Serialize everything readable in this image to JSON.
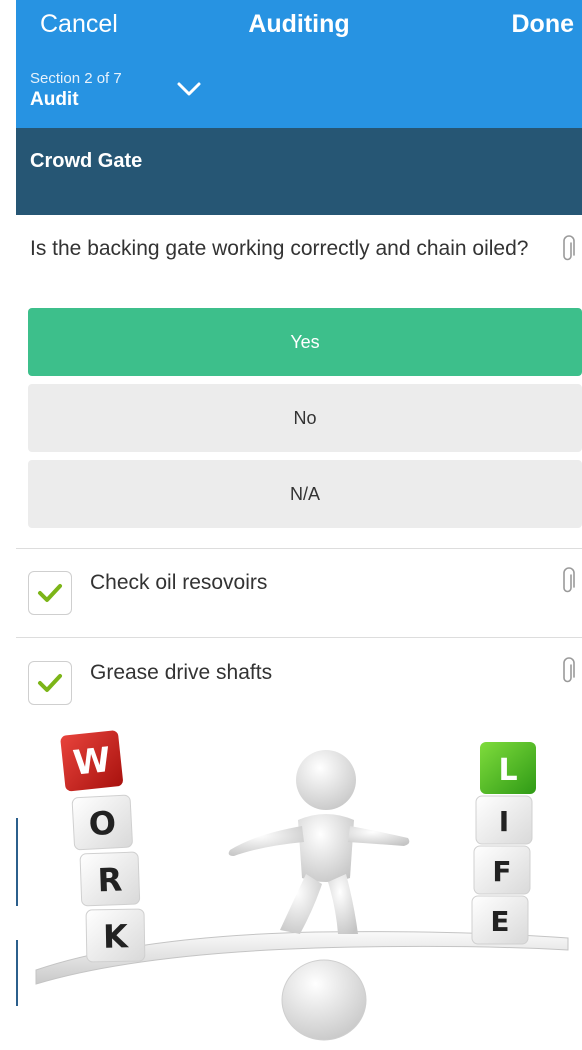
{
  "nav": {
    "cancel_label": "Cancel",
    "title": "Auditing",
    "done_label": "Done"
  },
  "section": {
    "progress": "Section 2 of 7",
    "name": "Audit"
  },
  "group": {
    "title": "Crowd Gate"
  },
  "question": {
    "text": "Is the backing gate working correctly and chain oiled?",
    "answers": [
      {
        "label": "Yes",
        "selected": true
      },
      {
        "label": "No",
        "selected": false
      },
      {
        "label": "N/A",
        "selected": false
      }
    ]
  },
  "checklist": [
    {
      "label": "Check oil resovoirs",
      "checked": true
    },
    {
      "label": "Grease drive shafts",
      "checked": true
    }
  ],
  "illustration": {
    "work_letters": [
      "W",
      "O",
      "R",
      "K"
    ],
    "life_letters": [
      "L",
      "I",
      "F",
      "E"
    ]
  },
  "colors": {
    "nav_blue": "#2793e2",
    "group_header": "#265674",
    "selected_answer": "#3dbf8b",
    "check_green": "#7cb518"
  }
}
